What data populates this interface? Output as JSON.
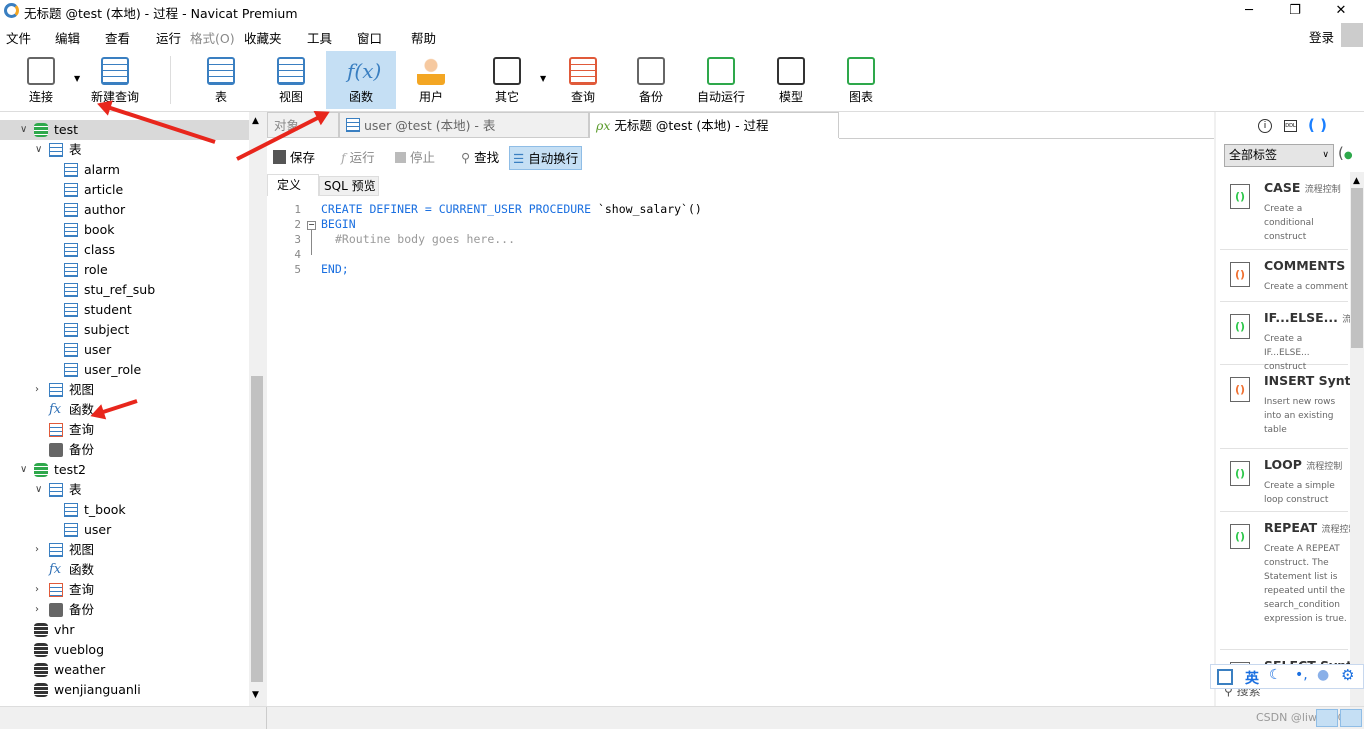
{
  "window": {
    "title": "无标题 @test (本地) - 过程 - Navicat Premium",
    "minimize": "─",
    "maximize": "❐",
    "close": "✕"
  },
  "menu": [
    "文件",
    "编辑",
    "查看",
    "运行",
    "格式(O)",
    "收藏夹",
    "工具",
    "窗口",
    "帮助"
  ],
  "login": "登录",
  "toolbar": [
    {
      "label": "连接",
      "icon": "connect-icon",
      "color": "#666"
    },
    {
      "label": "新建查询",
      "icon": "new-query-icon",
      "color": "#3a7fc1"
    },
    {
      "label": "表",
      "icon": "table-icon",
      "color": "#3a7fc1"
    },
    {
      "label": "视图",
      "icon": "view-icon",
      "color": "#3a7fc1"
    },
    {
      "label": "函数",
      "icon": "function-icon",
      "color": "#3a7fc1",
      "active": true
    },
    {
      "label": "用户",
      "icon": "user-icon",
      "color": "#f3a623"
    },
    {
      "label": "其它",
      "icon": "tools-icon",
      "color": "#333"
    },
    {
      "label": "查询",
      "icon": "query-icon",
      "color": "#e05a3a"
    },
    {
      "label": "备份",
      "icon": "backup-icon",
      "color": "#666"
    },
    {
      "label": "自动运行",
      "icon": "auto-run-icon",
      "color": "#2ea84b"
    },
    {
      "label": "模型",
      "icon": "model-icon",
      "color": "#333"
    },
    {
      "label": "图表",
      "icon": "chart-icon",
      "color": "#2ea84b"
    }
  ],
  "tree": [
    {
      "label": "test",
      "depth": 0,
      "type": "db-green",
      "expanded": true,
      "selected": true
    },
    {
      "label": "表",
      "depth": 1,
      "type": "table",
      "expanded": true
    },
    {
      "label": "alarm",
      "depth": 2,
      "type": "table"
    },
    {
      "label": "article",
      "depth": 2,
      "type": "table"
    },
    {
      "label": "author",
      "depth": 2,
      "type": "table"
    },
    {
      "label": "book",
      "depth": 2,
      "type": "table"
    },
    {
      "label": "class",
      "depth": 2,
      "type": "table"
    },
    {
      "label": "role",
      "depth": 2,
      "type": "table"
    },
    {
      "label": "stu_ref_sub",
      "depth": 2,
      "type": "table"
    },
    {
      "label": "student",
      "depth": 2,
      "type": "table"
    },
    {
      "label": "subject",
      "depth": 2,
      "type": "table"
    },
    {
      "label": "user",
      "depth": 2,
      "type": "table"
    },
    {
      "label": "user_role",
      "depth": 2,
      "type": "table"
    },
    {
      "label": "视图",
      "depth": 1,
      "type": "view",
      "collapsed": true
    },
    {
      "label": "函数",
      "depth": 1,
      "type": "function"
    },
    {
      "label": "查询",
      "depth": 1,
      "type": "query"
    },
    {
      "label": "备份",
      "depth": 1,
      "type": "backup"
    },
    {
      "label": "test2",
      "depth": 0,
      "type": "db-green",
      "expanded": true
    },
    {
      "label": "表",
      "depth": 1,
      "type": "table",
      "expanded": true
    },
    {
      "label": "t_book",
      "depth": 2,
      "type": "table"
    },
    {
      "label": "user",
      "depth": 2,
      "type": "table"
    },
    {
      "label": "视图",
      "depth": 1,
      "type": "view",
      "collapsed": true
    },
    {
      "label": "函数",
      "depth": 1,
      "type": "function"
    },
    {
      "label": "查询",
      "depth": 1,
      "type": "query",
      "collapsed": true
    },
    {
      "label": "备份",
      "depth": 1,
      "type": "backup",
      "collapsed": true
    },
    {
      "label": "vhr",
      "depth": 0,
      "type": "db"
    },
    {
      "label": "vueblog",
      "depth": 0,
      "type": "db"
    },
    {
      "label": "weather",
      "depth": 0,
      "type": "db"
    },
    {
      "label": "wenjianguanli",
      "depth": 0,
      "type": "db"
    }
  ],
  "tabs": [
    {
      "label": "对象"
    },
    {
      "label": "user @test (本地) - 表"
    },
    {
      "label": "无标题 @test (本地) - 过程",
      "active": true
    }
  ],
  "editor_toolbar": {
    "save": "保存",
    "run": "运行",
    "stop": "停止",
    "find": "查找",
    "wrap": "自动换行"
  },
  "subtabs": [
    "定义",
    "SQL 预览"
  ],
  "code": {
    "line1": {
      "kw": "CREATE DEFINER = CURRENT_USER PROCEDURE",
      "rest": " `show_salary`()"
    },
    "line2": "BEGIN",
    "line3": "#Routine body goes here...",
    "line5": "END;",
    "line_numbers": [
      "1",
      "2",
      "3",
      "4",
      "5"
    ]
  },
  "right_panel": {
    "filter": "全部标签",
    "snippets": [
      {
        "name": "CASE",
        "tag": "流程控制",
        "desc": "Create a conditional construct",
        "color": "#2ec84b"
      },
      {
        "name": "COMMENTS",
        "tag": "注",
        "desc": "Create a comment",
        "color": "#f07030"
      },
      {
        "name": "IF...ELSE...",
        "tag": "流程控",
        "desc": "Create a IF...ELSE... construct",
        "color": "#2ec84b"
      },
      {
        "name": "INSERT Syntax",
        "tag": "",
        "desc": "Insert new rows into an existing table",
        "color": "#f07030"
      },
      {
        "name": "LOOP",
        "tag": "流程控制",
        "desc": "Create a simple loop construct",
        "color": "#2ec84b"
      },
      {
        "name": "REPEAT",
        "tag": "流程控制",
        "desc": "Create A REPEAT construct. The Statement list is repeated until the search_condition expression is true.",
        "color": "#2ec84b"
      },
      {
        "name": "SELECT Syntax",
        "tag": "",
        "desc": "",
        "color": "#f07030"
      }
    ],
    "search": "搜索"
  },
  "ime": [
    "英"
  ],
  "watermark": "CSDN @liwangC"
}
